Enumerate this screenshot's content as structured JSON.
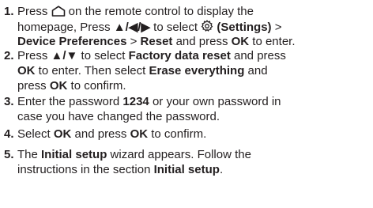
{
  "colors": {
    "text": "#231f20",
    "background": "#ffffff"
  },
  "icons": {
    "home": "home-icon",
    "settings": "gear-icon"
  },
  "steps": [
    {
      "number": "1.",
      "l1": {
        "a": "Press ",
        "b": " on the remote control to display the"
      },
      "l2": {
        "a": "homepage, Press ",
        "arrows": "▲/◀/▶",
        "b": " to select ",
        "settings": " (Settings)",
        "c": " >"
      },
      "l3": {
        "device": "Device Preferences",
        "a": " > ",
        "reset": "Reset",
        "b": " and press ",
        "ok": "OK",
        "c": " to enter."
      }
    },
    {
      "number": "2.",
      "l1": {
        "a": "Press ",
        "arrows": "▲/▼",
        "b": " to select ",
        "fdr": "Factory data reset",
        "c": " and press"
      },
      "l2": {
        "ok": "OK",
        "a": " to enter. Then select ",
        "erase": "Erase everything",
        "b": " and"
      },
      "l3": {
        "a": "press ",
        "ok": "OK",
        "b": " to confirm."
      }
    },
    {
      "number": "3.",
      "l1": {
        "a": "Enter the password ",
        "pw": "1234",
        "b": " or your own password in"
      },
      "l2": {
        "a": "case you have changed the password."
      }
    },
    {
      "number": "4.",
      "l1": {
        "a": "Select ",
        "ok1": "OK",
        "b": " and press ",
        "ok2": "OK",
        "c": " to confirm."
      }
    },
    {
      "number": "5.",
      "l1": {
        "a": "The ",
        "initial": "Initial setup",
        "b": " wizard appears. Follow the"
      },
      "l2": {
        "a": "instructions in the section ",
        "initial": "Initial setup",
        "b": "."
      }
    }
  ]
}
